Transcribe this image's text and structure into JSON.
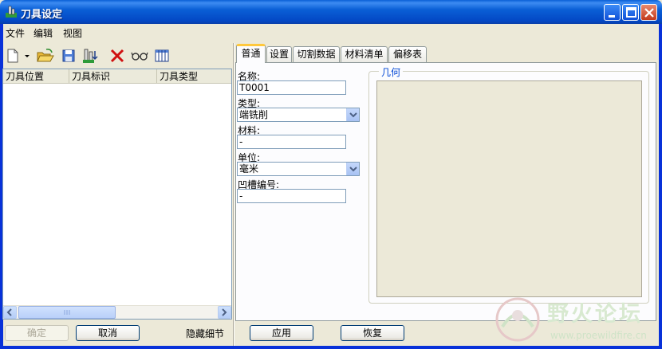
{
  "window": {
    "title": "刀具设定"
  },
  "menu": [
    "文件",
    "编辑",
    "视图"
  ],
  "toolbar": {
    "icons": [
      "new-file-icon",
      "dropdown-arrow-icon",
      "open-folder-icon",
      "save-disk-icon",
      "tool-assembly-icon",
      "delete-x-icon",
      "glasses-icon",
      "columns-table-icon"
    ]
  },
  "table": {
    "columns": [
      "刀具位置",
      "刀具标识",
      "刀具类型"
    ],
    "rows": []
  },
  "tabs": [
    "普通",
    "设置",
    "切割数据",
    "材料清单",
    "偏移表"
  ],
  "form": {
    "name_label": "名称:",
    "name_value": "T0001",
    "type_label": "类型:",
    "type_value": "端铣削",
    "material_label": "材料:",
    "material_value": "-",
    "unit_label": "单位:",
    "unit_value": "毫米",
    "slot_label": "凹槽编号:",
    "slot_value": "-"
  },
  "geometry_group": {
    "title": "几何"
  },
  "buttons": {
    "ok": "确定",
    "cancel": "取消",
    "hide_details": "隐藏细节",
    "apply": "应用",
    "restore": "恢复"
  },
  "watermark": {
    "text": "野火论坛",
    "url": "www.proewildfire.cn"
  },
  "colors": {
    "titlebar": "#0a5fd6",
    "tab_highlight": "#ffc83c",
    "group_title": "#0046d5"
  }
}
